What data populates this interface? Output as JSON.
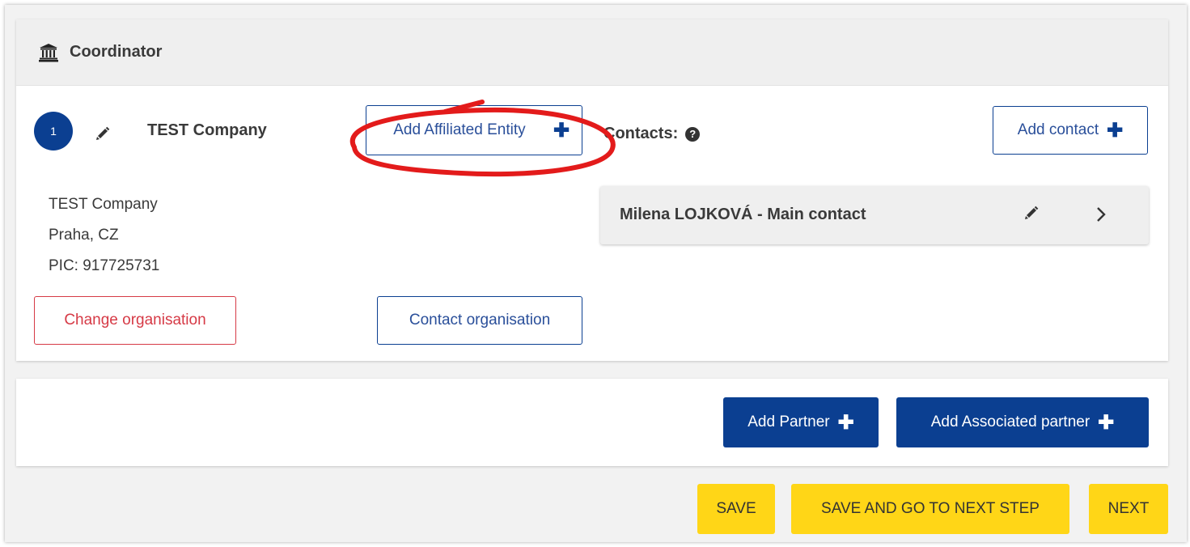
{
  "coordinator": {
    "title": "Coordinator",
    "badge_number": "1",
    "org_name": "TEST Company",
    "add_affiliated_label": "Add Affiliated Entity",
    "contacts_label": "Contacts:",
    "add_contact_label": "Add contact",
    "org_details": {
      "name": "TEST Company",
      "location": "Praha, CZ",
      "pic": "PIC: 917725731"
    },
    "contacts": [
      {
        "label": "Milena LOJKOVÁ - Main contact"
      }
    ],
    "change_org_label": "Change organisation",
    "contact_org_label": "Contact organisation"
  },
  "partners": {
    "add_partner_label": "Add Partner",
    "add_associated_label": "Add Associated partner"
  },
  "actions": {
    "save_label": "SAVE",
    "save_next_label": "SAVE AND GO TO NEXT STEP",
    "next_label": "NEXT"
  },
  "icons": {
    "header": "bank-icon",
    "edit": "pencil-icon",
    "add": "plus-icon",
    "help": "question-circle-icon",
    "expand": "chevron-right-icon"
  },
  "colors": {
    "primary": "#0b3f91",
    "danger": "#d63a46",
    "action_yellow": "#ffd617",
    "annotation_red": "#e31b1b",
    "header_bg": "#efefef"
  }
}
